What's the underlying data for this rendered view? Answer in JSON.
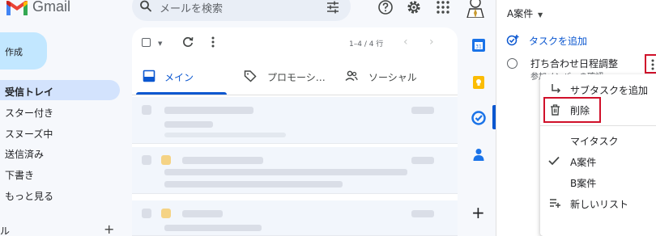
{
  "app": {
    "logo_text": "Gmail"
  },
  "search": {
    "placeholder": "メールを検索"
  },
  "sidebar": {
    "compose_label": "作成",
    "items": [
      {
        "label": "受信トレイ",
        "active": true
      },
      {
        "label": "スター付き"
      },
      {
        "label": "スヌーズ中"
      },
      {
        "label": "送信済み"
      },
      {
        "label": "下書き"
      },
      {
        "label": "もっと見る"
      }
    ],
    "labels_heading": "ル",
    "labels_add": "+"
  },
  "toolbar": {
    "count": "1–4 / 4 行",
    "prev": "‹",
    "next": "›"
  },
  "tabs": [
    {
      "label": "メイン",
      "active": true
    },
    {
      "label": "プロモーシ…"
    },
    {
      "label": "ソーシャル"
    }
  ],
  "tasks": {
    "list_name": "A案件",
    "add_task": "タスクを追加",
    "task_title": "打ち合わせ日程調整",
    "task_subtitle": "参加メンバーの確認"
  },
  "context_menu": {
    "items": [
      {
        "label": "サブタスクを追加",
        "icon": "subtask-icon"
      },
      {
        "label": "削除",
        "icon": "trash-icon",
        "highlighted": true
      }
    ],
    "lists": [
      {
        "label": "マイタスク"
      },
      {
        "label": "A案件",
        "checked": true
      },
      {
        "label": "B案件"
      }
    ],
    "new_list": "新しいリスト"
  },
  "side_strip": {
    "add": "+"
  },
  "colors": {
    "accent": "#0b57d0",
    "compose_bg": "#c2e7ff",
    "nav_active_bg": "#d3e3fd",
    "highlight_border": "#d0102a"
  }
}
